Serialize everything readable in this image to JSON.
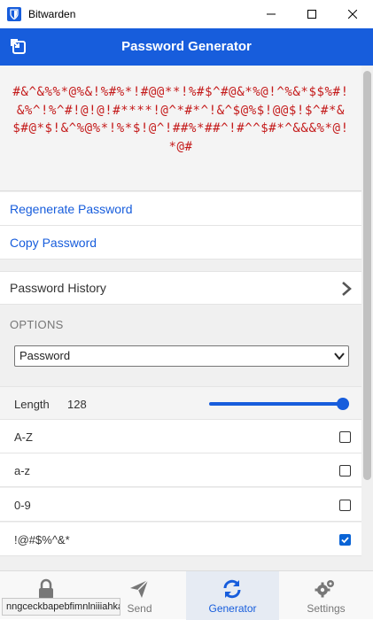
{
  "window": {
    "title": "Bitwarden"
  },
  "header": {
    "title": "Password Generator"
  },
  "password": {
    "value": "#&^&%%*@%&!%#%*!#@@**!%#$^#@&*%@!^%&*$$%#!&%^!%^#!@!@!#****!@^*#*^!&^$@%$!@@$!$^#*&$#@*$!&^%@%*!%*$!@^!##%*##^!#^^$#*^&&&%*@!*@#"
  },
  "actions": {
    "regenerate": "Regenerate Password",
    "copy": "Copy Password",
    "history": "Password History"
  },
  "options": {
    "section_label": "OPTIONS",
    "type_selected": "Password",
    "length_label": "Length",
    "length_value": "128",
    "length_fraction": 1.0,
    "az_upper": "A-Z",
    "az_lower": "a-z",
    "digits": "0-9",
    "special": "!@#$%^&*",
    "az_upper_checked": false,
    "az_lower_checked": false,
    "digits_checked": false,
    "special_checked": true
  },
  "tabs": [
    {
      "label": ""
    },
    {
      "label": "Send"
    },
    {
      "label": "Generator"
    },
    {
      "label": "Settings"
    }
  ],
  "tooltip": {
    "text": "nngceckbapebfimnlniiiahkandclblb"
  },
  "colors": {
    "brand": "#175ddc",
    "password": "#c41a1a",
    "checkbox": "#0a64d6"
  }
}
